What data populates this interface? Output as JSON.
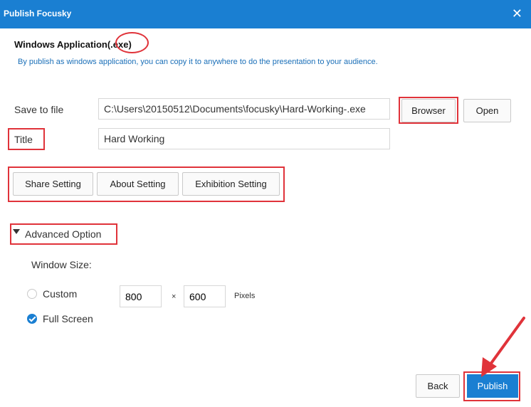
{
  "window": {
    "title": "Publish Focusky",
    "close_glyph": "✕"
  },
  "heading": {
    "prefix": "Windows Application",
    "ext": "(.exe)"
  },
  "description": "By publish as windows application, you can copy it to anywhere to do the presentation to your audience.",
  "save": {
    "label": "Save to file",
    "value": "C:\\Users\\20150512\\Documents\\focusky\\Hard-Working-.exe",
    "browse_label": "Browser",
    "open_label": "Open"
  },
  "title_field": {
    "label": "Title",
    "value": "Hard Working"
  },
  "settings": [
    "Share Setting",
    "About Setting",
    "Exhibition Setting"
  ],
  "advanced": {
    "label": "Advanced Option",
    "window_size_label": "Window Size:",
    "custom_label": "Custom",
    "width": "800",
    "times": "×",
    "height": "600",
    "unit": "Pixels",
    "fullscreen_label": "Full Screen",
    "selected": "Full Screen"
  },
  "footer": {
    "back_label": "Back",
    "publish_label": "Publish"
  },
  "colors": {
    "accent": "#1a7fd2",
    "annotation": "#e0333a"
  }
}
